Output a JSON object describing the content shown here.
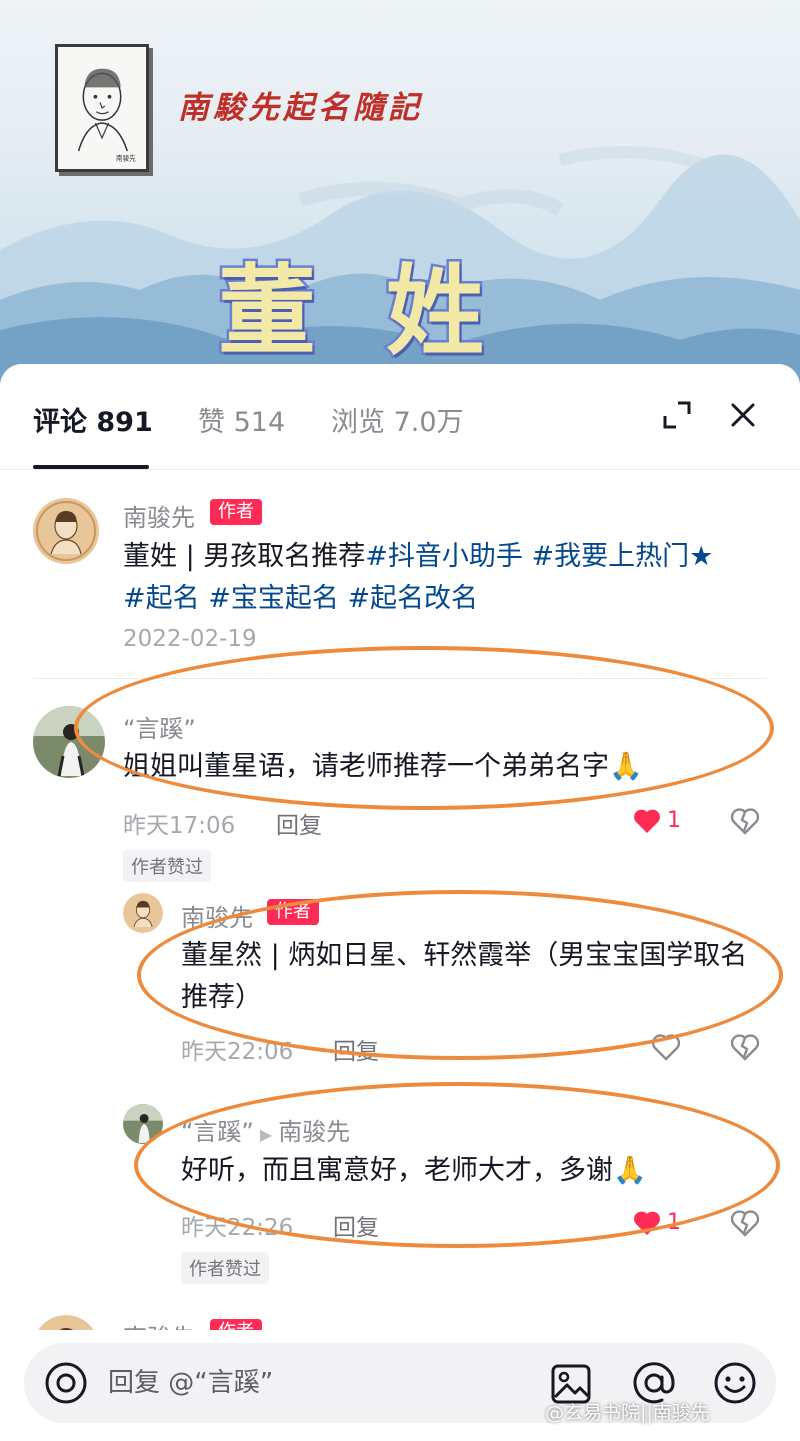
{
  "banner": {
    "brand": "南駿先起名隨記",
    "surname": "董姓",
    "portrait_signature": "南骏先"
  },
  "header": {
    "tabs": [
      {
        "label": "评论 891",
        "active": true
      },
      {
        "label": "赞 514",
        "active": false
      },
      {
        "label": "浏览 7.0万",
        "active": false
      }
    ],
    "expand_icon": "expand-icon",
    "close_icon": "close-icon"
  },
  "post": {
    "user": "南骏先",
    "author_tag": "作者",
    "text_plain": "董姓 | 男孩取名推荐",
    "tags": [
      "#抖音小助手",
      "#我要上热门★",
      "#起名",
      "#宝宝起名",
      "#起名改名"
    ],
    "date": "2022-02-19"
  },
  "comments": [
    {
      "user": "“言蹊”",
      "text": "姐姐叫董星语，请老师推荐一个弟弟名字🙏",
      "time": "昨天17:06",
      "reply_label": "回复",
      "likes": "1",
      "liked": true,
      "author_liked": "作者赞过"
    },
    {
      "user": "南骏先",
      "author_tag": "作者",
      "text": "董星然 | 炳如日星、轩然霞举（男宝宝国学取名推荐）",
      "time": "昨天22:06",
      "reply_label": "回复",
      "likes": "",
      "liked": false
    },
    {
      "user": "“言蹊”",
      "reply_to": "南骏先",
      "text": "好听，而且寓意好，老师大才，多谢🙏",
      "time": "昨天22:26",
      "reply_label": "回复",
      "likes": "1",
      "liked": true,
      "author_liked": "作者赞过"
    },
    {
      "user": "南骏先",
      "author_tag": "作者"
    }
  ],
  "input_bar": {
    "placeholder": "回复 @“言蹊”",
    "icons": [
      "camera-icon",
      "image-icon",
      "at-icon",
      "emoji-icon"
    ]
  },
  "watermark": "@玄易书院||南骏先",
  "colors": {
    "accent_red": "#fe2c55",
    "hashtag_blue": "#04498d",
    "highlight_orange": "#ee8a3c",
    "brand_red": "#c0302a"
  }
}
